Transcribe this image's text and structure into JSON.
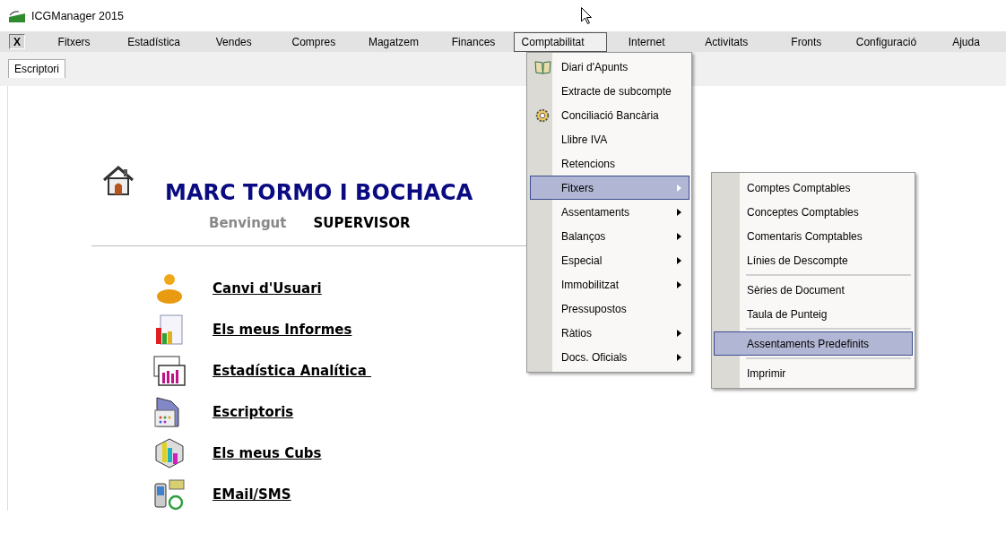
{
  "window": {
    "title": "ICGManager 2015"
  },
  "close_button": {
    "label": "X"
  },
  "menubar": {
    "items": [
      {
        "label": "Fitxers",
        "selected": false
      },
      {
        "label": "Estadística",
        "selected": false
      },
      {
        "label": "Vendes",
        "selected": false
      },
      {
        "label": "Compres",
        "selected": false
      },
      {
        "label": "Magatzem",
        "selected": false
      },
      {
        "label": "Finances",
        "selected": false
      },
      {
        "label": "Comptabilitat",
        "selected": true
      },
      {
        "label": "Internet",
        "selected": false
      },
      {
        "label": "Activitats",
        "selected": false
      },
      {
        "label": "Fronts",
        "selected": false
      },
      {
        "label": "Configuració",
        "selected": false
      },
      {
        "label": "Ajuda",
        "selected": false
      }
    ]
  },
  "tabs": [
    {
      "label": "Escriptori",
      "selected": true
    }
  ],
  "home": {
    "user_name": "MARC TORMO I BOCHACA",
    "greeting": "Benvingut",
    "role": "SUPERVISOR",
    "links": [
      {
        "label": "Canvi d'Usuari"
      },
      {
        "label": "Els meus Informes"
      },
      {
        "label": "Estadística Analítica "
      },
      {
        "label": "Escriptoris"
      },
      {
        "label": "Els meus Cubs"
      },
      {
        "label": "EMail/SMS"
      }
    ]
  },
  "dropdown": {
    "items": [
      {
        "label": "Diari d'Apunts",
        "has_submenu": false,
        "selected": false
      },
      {
        "label": "Extracte de subcompte",
        "has_submenu": false,
        "selected": false
      },
      {
        "label": "Conciliació Bancària",
        "has_submenu": false,
        "selected": false
      },
      {
        "label": "Llibre IVA",
        "has_submenu": false,
        "selected": false
      },
      {
        "label": "Retencions",
        "has_submenu": false,
        "selected": false
      },
      {
        "label": "Fitxers",
        "has_submenu": true,
        "selected": true
      },
      {
        "label": "Assentaments",
        "has_submenu": true,
        "selected": false
      },
      {
        "label": "Balanços",
        "has_submenu": true,
        "selected": false
      },
      {
        "label": "Especial",
        "has_submenu": true,
        "selected": false
      },
      {
        "label": "Immobilitzat",
        "has_submenu": true,
        "selected": false
      },
      {
        "label": "Pressupostos",
        "has_submenu": false,
        "selected": false
      },
      {
        "label": "Ràtios",
        "has_submenu": true,
        "selected": false
      },
      {
        "label": "Docs. Oficials",
        "has_submenu": true,
        "selected": false
      }
    ]
  },
  "submenu": {
    "items": [
      {
        "label": "Comptes Comptables",
        "separator_before": false,
        "selected": false
      },
      {
        "label": "Conceptes Comptables",
        "separator_before": false,
        "selected": false
      },
      {
        "label": "Comentaris Comptables",
        "separator_before": false,
        "selected": false
      },
      {
        "label": "Línies de Descompte",
        "separator_before": false,
        "selected": false
      },
      {
        "label": "Sèries de Document",
        "separator_before": true,
        "selected": false
      },
      {
        "label": "Taula de Punteig",
        "separator_before": false,
        "selected": false
      },
      {
        "label": "Assentaments Predefinits",
        "separator_before": true,
        "selected": true
      },
      {
        "label": "Imprimir",
        "separator_before": true,
        "selected": false
      }
    ]
  }
}
